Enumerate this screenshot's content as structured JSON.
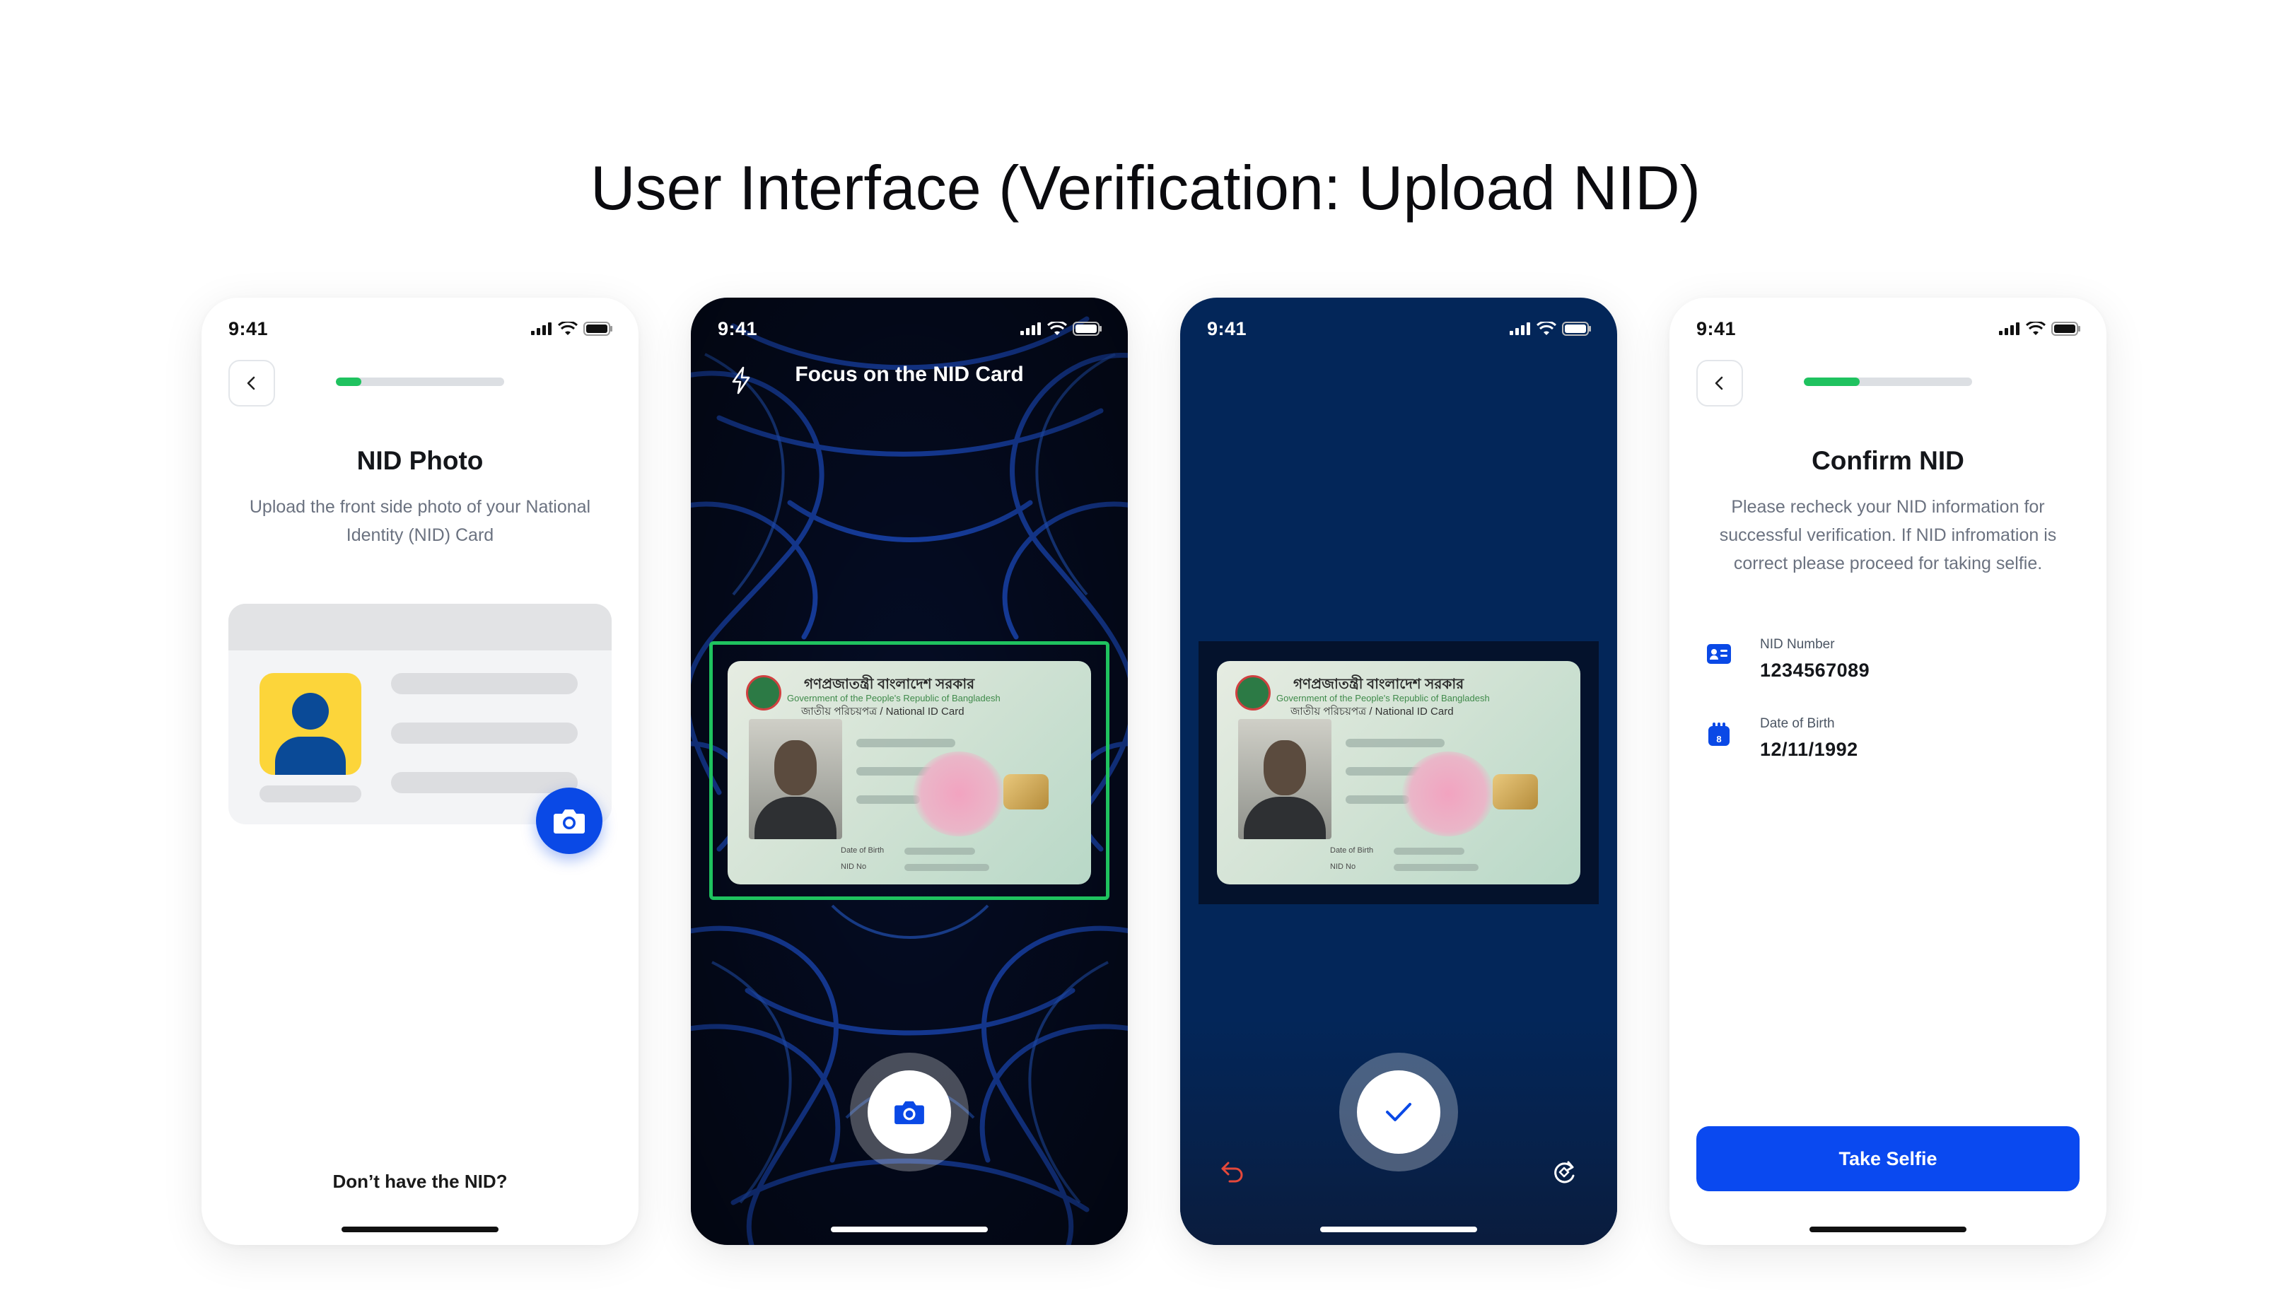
{
  "page": {
    "title": "User Interface (Verification: Upload NID)"
  },
  "status_bar": {
    "time": "9:41"
  },
  "screen1": {
    "title": "NID Photo",
    "subtitle": "Upload the front side photo of your National Identity (NID) Card",
    "progress": 0.15,
    "camera_icon": "camera-icon",
    "bottom_link": "Don’t have the NID?"
  },
  "screen2": {
    "header": "Focus on the NID Card",
    "flash_icon": "flash-icon",
    "frame_color": "#1fc25f"
  },
  "screen3": {
    "confirm_icon": "check-icon",
    "retake_icon": "undo-icon",
    "rotate_icon": "rotate-icon"
  },
  "nid_card": {
    "title_bn": "গণপ্রজাতন্ত্রী বাংলাদেশ সরকার",
    "subtitle_en": "Government of the People's Republic of Bangladesh",
    "card_type": "জাতীয় পরিচয়পত্র / National ID Card",
    "dob_label": "Date of Birth",
    "nid_label": "NID No"
  },
  "screen4": {
    "title": "Confirm NID",
    "subtitle": "Please recheck your NID information for successful verification. If NID infromation is correct please proceed for taking selfie.",
    "progress": 0.33,
    "nid_number_label": "NID Number",
    "nid_number": "1234567089",
    "dob_label": "Date of Birth",
    "dob": "12/11/1992",
    "button": "Take Selfie"
  },
  "colors": {
    "accent": "#0a49f0",
    "success": "#1fc25f",
    "avatar_bg": "#fcd53a"
  }
}
